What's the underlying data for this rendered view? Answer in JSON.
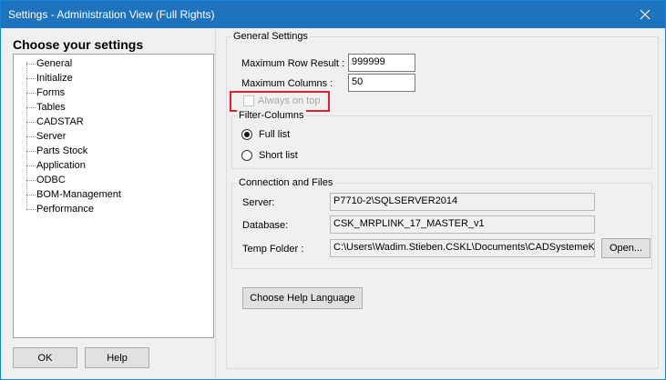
{
  "window": {
    "title": "Settings - Administration View (Full Rights)",
    "close_icon": "close-icon"
  },
  "left": {
    "heading": "Choose your settings",
    "tree": [
      "General",
      "Initialize",
      "Forms",
      "Tables",
      "CADSTAR",
      "Server",
      "Parts Stock",
      "Application",
      "ODBC",
      "BOM-Management",
      "Performance"
    ],
    "ok_label": "OK",
    "help_label": "Help"
  },
  "general": {
    "title": "General Settings",
    "max_row_label": "Maximum Row Result :",
    "max_row_value": "999999",
    "max_cols_label": "Maximum Columns :",
    "max_cols_value": "50",
    "always_on_top_label": "Always on top",
    "always_on_top_checked": false,
    "highlight_color": "#e0202a"
  },
  "filter": {
    "title": "Filter-Columns",
    "full_list": "Full list",
    "short_list": "Short list",
    "selected": "Full list"
  },
  "connection": {
    "title": "Connection and Files",
    "server_label": "Server:",
    "server_value": "P7710-2\\SQLSERVER2014",
    "database_label": "Database:",
    "database_value": "CSK_MRPLINK_17_MASTER_v1",
    "temp_label": "Temp Folder :",
    "temp_value": "C:\\Users\\Wadim.Stieben.CSKL\\Documents\\CADSystemeKl",
    "open_label": "Open..."
  },
  "help_language_label": "Choose Help Language"
}
